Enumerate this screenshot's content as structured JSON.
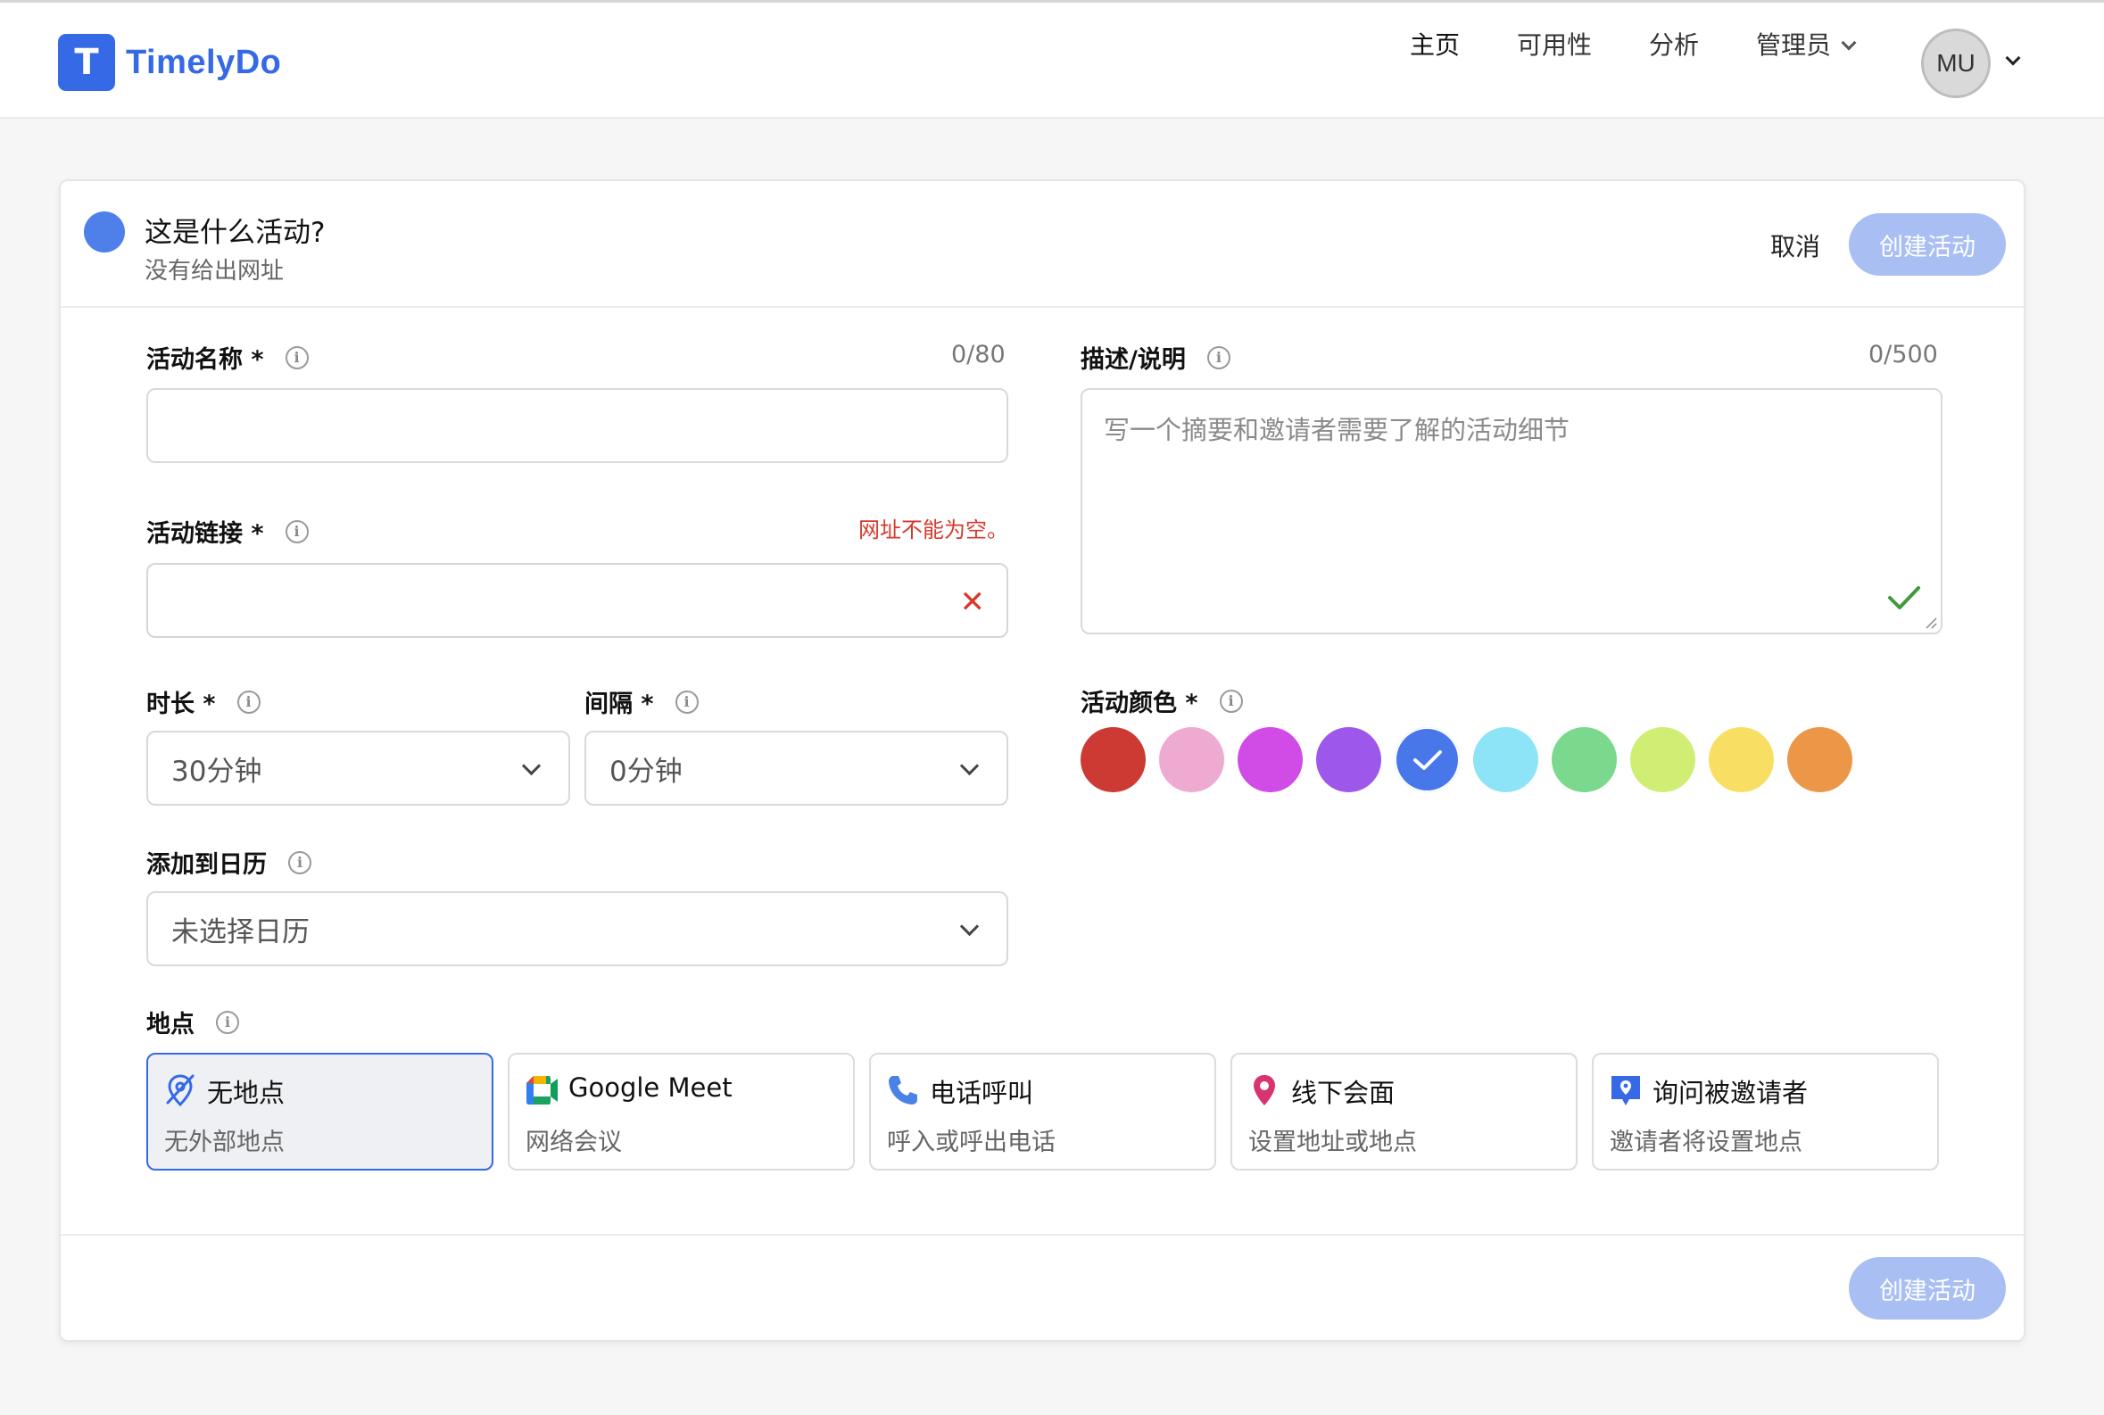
{
  "app": {
    "logo_letter": "T",
    "name": "TimelyDo",
    "brand_color": "#3569e6"
  },
  "nav": {
    "items": [
      {
        "label": "主页"
      },
      {
        "label": "可用性"
      },
      {
        "label": "分析"
      },
      {
        "label": "管理员"
      }
    ],
    "avatar_initials": "MU"
  },
  "header": {
    "title": "这是什么活动?",
    "subtitle": "没有给出网址",
    "cancel_label": "取消",
    "create_label": "创建活动"
  },
  "form": {
    "event_name": {
      "label": "活动名称 *",
      "counter": "0/80",
      "value": ""
    },
    "event_link": {
      "label": "活动链接 *",
      "error": "网址不能为空。",
      "value": ""
    },
    "description": {
      "label": "描述/说明",
      "counter": "0/500",
      "placeholder": "写一个摘要和邀请者需要了解的活动细节"
    },
    "duration": {
      "label": "时长 *",
      "value": "30分钟"
    },
    "interval": {
      "label": "间隔 *",
      "value": "0分钟"
    },
    "calendar": {
      "label": "添加到日历",
      "value": "未选择日历"
    },
    "event_color": {
      "label": "活动颜色 *",
      "colors": [
        "#cc3a33",
        "#eeaad0",
        "#d14be6",
        "#9d57ea",
        "#4877ea",
        "#8ce4f6",
        "#7ad98d",
        "#cfee73",
        "#f8df64",
        "#ec9647"
      ],
      "selected_index": 4
    },
    "location": {
      "label": "地点",
      "options": [
        {
          "title": "无地点",
          "subtitle": "无外部地点",
          "icon": "no-location-icon",
          "selected": true
        },
        {
          "title": "Google Meet",
          "subtitle": "网络会议",
          "icon": "google-meet-icon",
          "selected": false
        },
        {
          "title": "电话呼叫",
          "subtitle": "呼入或呼出电话",
          "icon": "phone-icon",
          "selected": false
        },
        {
          "title": "线下会面",
          "subtitle": "设置地址或地点",
          "icon": "map-pin-icon",
          "selected": false
        },
        {
          "title": "询问被邀请者",
          "subtitle": "邀请者将设置地点",
          "icon": "chat-pin-icon",
          "selected": false
        }
      ]
    }
  },
  "footer": {
    "create_label": "创建活动"
  }
}
